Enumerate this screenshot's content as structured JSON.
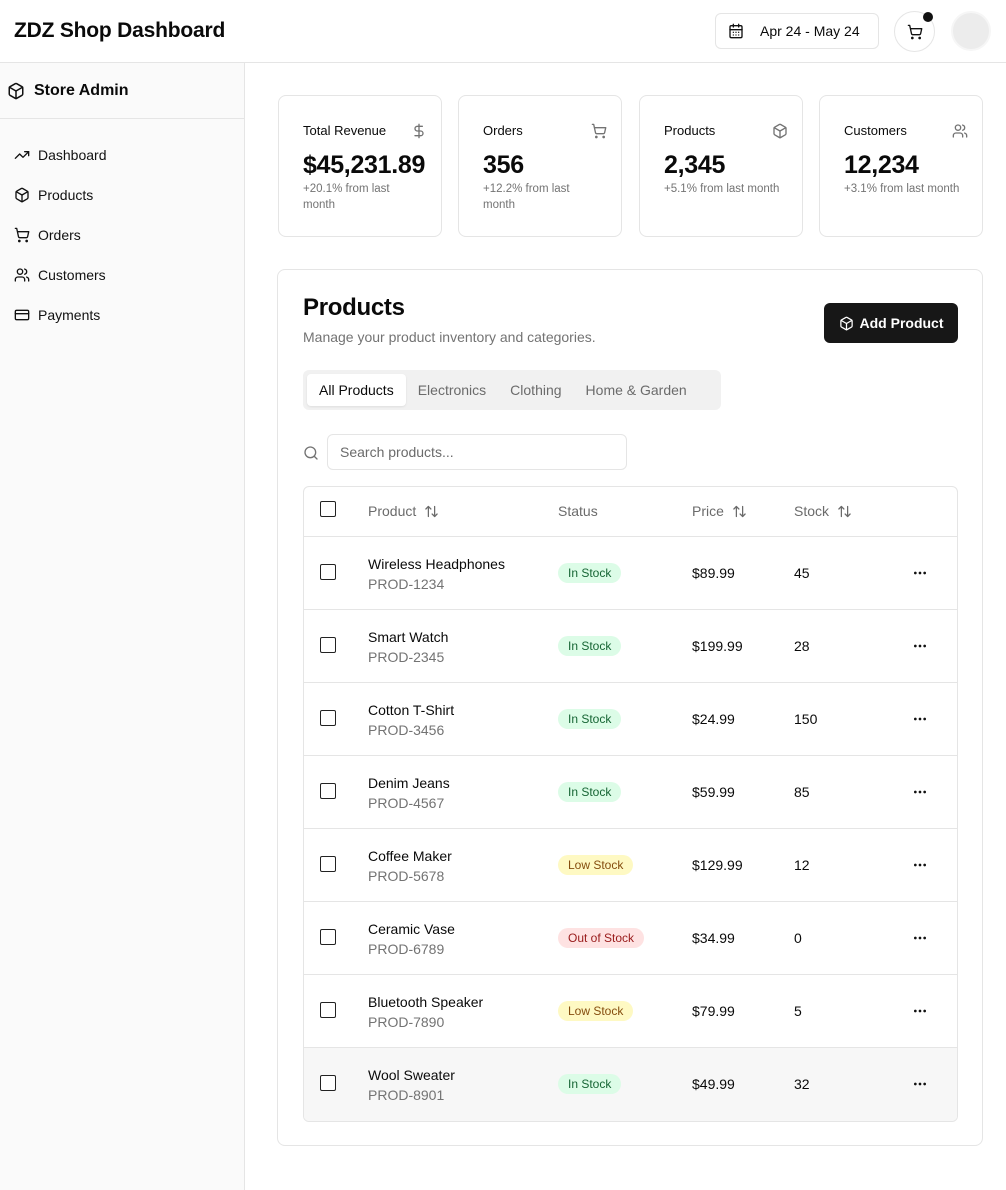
{
  "header": {
    "title": "ZDZ Shop Dashboard",
    "date_range": "Apr 24 - May 24"
  },
  "sidebar": {
    "brand": "Store Admin",
    "items": [
      {
        "label": "Dashboard",
        "icon": "trending-up-icon"
      },
      {
        "label": "Products",
        "icon": "package-icon"
      },
      {
        "label": "Orders",
        "icon": "cart-icon"
      },
      {
        "label": "Customers",
        "icon": "users-icon"
      },
      {
        "label": "Payments",
        "icon": "credit-card-icon"
      }
    ]
  },
  "stats": [
    {
      "label": "Total Revenue",
      "value": "$45,231.89",
      "note": "+20.1% from last month",
      "icon": "dollar-icon"
    },
    {
      "label": "Orders",
      "value": "356",
      "note": "+12.2% from last month",
      "icon": "cart-icon"
    },
    {
      "label": "Products",
      "value": "2,345",
      "note": "+5.1% from last month",
      "icon": "package-icon"
    },
    {
      "label": "Customers",
      "value": "12,234",
      "note": "+3.1% from last month",
      "icon": "users-icon"
    }
  ],
  "products_panel": {
    "title": "Products",
    "subtitle": "Manage your product inventory and categories.",
    "add_button": "Add Product",
    "tabs": [
      "All Products",
      "Electronics",
      "Clothing",
      "Home & Garden"
    ],
    "active_tab": "All Products",
    "search_placeholder": "Search products...",
    "columns": [
      "Product",
      "Status",
      "Price",
      "Stock"
    ],
    "rows": [
      {
        "name": "Wireless Headphones",
        "id": "PROD-1234",
        "status": "In Stock",
        "status_kind": "in",
        "price": "$89.99",
        "stock": "45"
      },
      {
        "name": "Smart Watch",
        "id": "PROD-2345",
        "status": "In Stock",
        "status_kind": "in",
        "price": "$199.99",
        "stock": "28"
      },
      {
        "name": "Cotton T-Shirt",
        "id": "PROD-3456",
        "status": "In Stock",
        "status_kind": "in",
        "price": "$24.99",
        "stock": "150"
      },
      {
        "name": "Denim Jeans",
        "id": "PROD-4567",
        "status": "In Stock",
        "status_kind": "in",
        "price": "$59.99",
        "stock": "85"
      },
      {
        "name": "Coffee Maker",
        "id": "PROD-5678",
        "status": "Low Stock",
        "status_kind": "low",
        "price": "$129.99",
        "stock": "12"
      },
      {
        "name": "Ceramic Vase",
        "id": "PROD-6789",
        "status": "Out of Stock",
        "status_kind": "out",
        "price": "$34.99",
        "stock": "0"
      },
      {
        "name": "Bluetooth Speaker",
        "id": "PROD-7890",
        "status": "Low Stock",
        "status_kind": "low",
        "price": "$79.99",
        "stock": "5"
      },
      {
        "name": "Wool Sweater",
        "id": "PROD-8901",
        "status": "In Stock",
        "status_kind": "in",
        "price": "$49.99",
        "stock": "32"
      }
    ]
  },
  "colors": {
    "primary_button": "#171717",
    "badge_in_bg": "#dcfce7",
    "badge_low_bg": "#fef9c3",
    "badge_out_bg": "#fee2e2"
  }
}
